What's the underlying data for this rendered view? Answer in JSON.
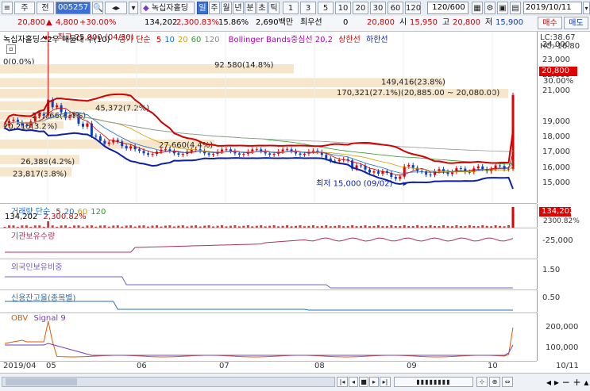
{
  "toolbar": {
    "market": "주",
    "mode": "전",
    "code": "005257",
    "name_tab": "녹십자홀딩",
    "period_tabs": [
      "일",
      "주",
      "월",
      "년",
      "분",
      "초",
      "틱"
    ],
    "period_selected": "일",
    "intervals": [
      "1",
      "3",
      "5",
      "10",
      "20",
      "30",
      "60",
      "120"
    ],
    "count": "120/600",
    "date": "2019/10/11"
  },
  "quote": {
    "price": "20,800",
    "change": "4,800",
    "change_pct": "+30.00%",
    "volume": "134,202",
    "vol_pct": "2,300.83%",
    "turnover_rate": "15.86%",
    "amount": "2,690백만",
    "min_qty_label": "최우선",
    "min_qty": "0",
    "price2": "20,800",
    "open_label": "시",
    "open": "15,950",
    "high_label": "고",
    "high": "20,800",
    "low_label": "저",
    "low": "15,900",
    "buy": "매수",
    "sell": "매도"
  },
  "price_panel": {
    "title": "녹십자홀딩스2우 매물대 수(10)",
    "ma_label": "종가 단순",
    "ma_periods": [
      "5",
      "10",
      "20",
      "60",
      "120"
    ],
    "bb_label": "Bollinger Bands중심선 20,2",
    "bb_upper": "상한선",
    "bb_lower": "하한선",
    "lc": "LC:38.67",
    "hc": "HC:-16.80",
    "high_note": "최고 25,000 (04/30)",
    "low_note": "최저 15,000 (09/02)",
    "current_tag": "20,800",
    "pct_tag": "30.00%",
    "y_ticks": [
      "24,000",
      "23,000",
      "22,000",
      "21,000",
      "19,000",
      "18,000",
      "17,000",
      "16,000",
      "15,000"
    ],
    "volume_profile": [
      {
        "label": "0(0.0%)"
      },
      {
        "label": "92,580(14.8%)"
      },
      {
        "label": "149,416(23.8%)"
      },
      {
        "label": "170,321(27.1%)(20,885.00 ~ 20,080.00)"
      },
      {
        "label": "45,372(7.2%)"
      },
      {
        "label": "27,766(4.4%)"
      },
      {
        "label": "20,215(3.2%)"
      },
      {
        "label": "27,660(4.4%)"
      },
      {
        "label": "26,389(4.2%)"
      },
      {
        "label": "23,817(3.8%)"
      }
    ]
  },
  "volume_panel": {
    "title": "거래량 단순",
    "periods": [
      "5",
      "20",
      "60",
      "120"
    ],
    "readout": "134,202",
    "readout_pct": "2,300.82%",
    "tag": "134,202",
    "tag2": "2300.82%"
  },
  "inst_panel": {
    "title": "기관보유수량",
    "tick": "-25,000"
  },
  "foreign_panel": {
    "title": "외국인보유비중",
    "tick": "1.50"
  },
  "credit_panel": {
    "title": "신용잔고율(종목별)",
    "tick": "0.50"
  },
  "obv_panel": {
    "title": "OBV",
    "signal": "Signal 9",
    "ticks": [
      "200,000",
      "100,000"
    ]
  },
  "x_axis": [
    "2019/04",
    "05",
    "06",
    "07",
    "08",
    "09",
    "10",
    "10/11"
  ],
  "colors": {
    "up": "#e00000",
    "down": "#0b3fc4",
    "bb": "#d40000",
    "bb_low": "#0b1fa8",
    "profile": "#f5e6cc"
  }
}
